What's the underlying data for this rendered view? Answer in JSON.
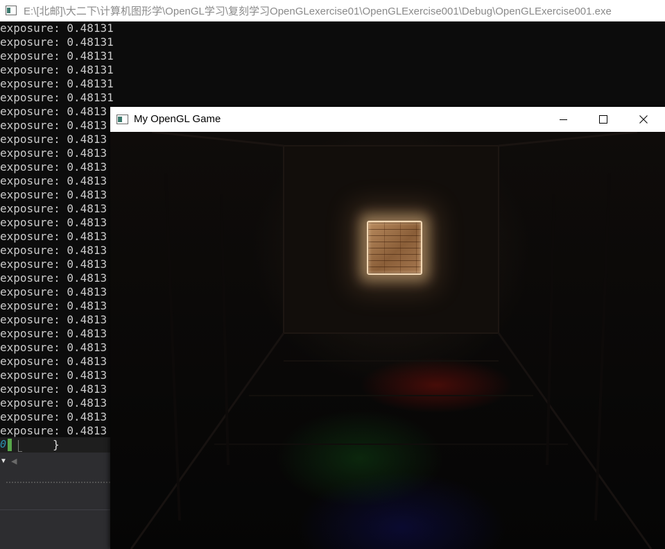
{
  "console": {
    "title": "E:\\[北邮]\\大二下\\计算机图形学\\OpenGL学习\\复刻学习OpenGLexercise01\\OpenGLExercise001\\Debug\\OpenGLExercise001.exe",
    "lines": [
      "exposure: 0.48131",
      "exposure: 0.48131",
      "exposure: 0.48131",
      "exposure: 0.48131",
      "exposure: 0.48131",
      "exposure: 0.48131",
      "exposure: 0.4813",
      "exposure: 0.4813",
      "exposure: 0.4813",
      "exposure: 0.4813",
      "exposure: 0.4813",
      "exposure: 0.4813",
      "exposure: 0.4813",
      "exposure: 0.4813",
      "exposure: 0.4813",
      "exposure: 0.4813",
      "exposure: 0.4813",
      "exposure: 0.4813",
      "exposure: 0.4813",
      "exposure: 0.4813",
      "exposure: 0.4813",
      "exposure: 0.4813",
      "exposure: 0.4813",
      "exposure: 0.4813",
      "exposure: 0.4813",
      "exposure: 0.4813",
      "exposure: 0.4813",
      "exposure: 0.4813",
      "exposure: 0.4813",
      "exposure: 0.4813"
    ]
  },
  "editor": {
    "line_number": "0",
    "code": "}"
  },
  "game_window": {
    "title": "My OpenGL Game"
  },
  "colors": {
    "console_bg": "#0c0c0c",
    "console_text": "#cccccc",
    "editor_bg": "#2d2d30",
    "titlebar_bg": "#ffffff"
  }
}
